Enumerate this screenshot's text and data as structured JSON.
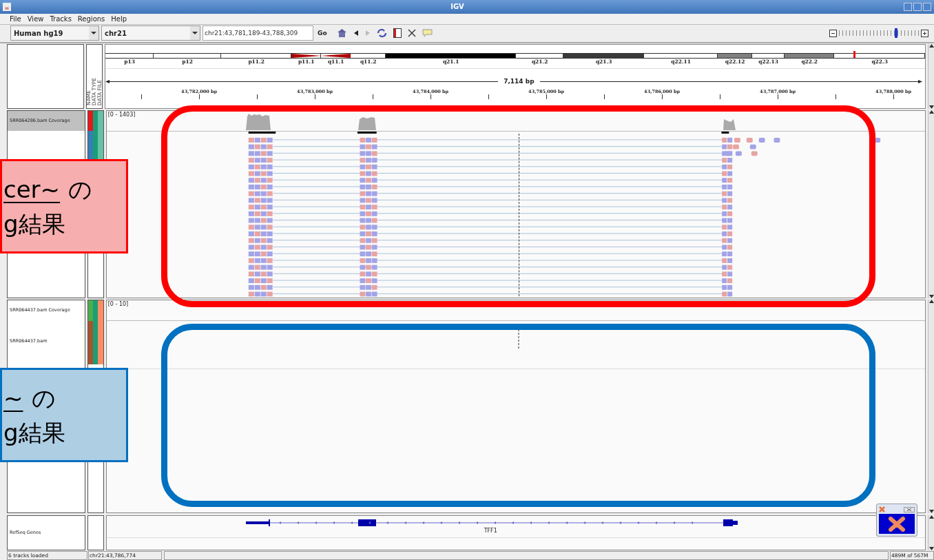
{
  "window": {
    "title": "IGV"
  },
  "menu": [
    "File",
    "View",
    "Tracks",
    "Regions",
    "Help"
  ],
  "toolbar": {
    "genome": "Human hg19",
    "chromosome": "chr21",
    "locus": "chr21:43,781,189-43,788,309",
    "go": "Go",
    "zoom": {
      "level": 0.72
    }
  },
  "ideogram": {
    "bands": [
      {
        "label": "p13",
        "color": "#ffffff"
      },
      {
        "label": "p12",
        "color": "#ffffff"
      },
      {
        "label": "p11.2",
        "color": "#ffffff"
      },
      {
        "label": "p11.1",
        "color": "#b00000",
        "kind": "centromere"
      },
      {
        "label": "q11.1",
        "color": "#b00000",
        "kind": "centromere"
      },
      {
        "label": "q11.2",
        "color": "#ffffff"
      },
      {
        "label": "q21.1",
        "color": "#000000"
      },
      {
        "label": "q21.2",
        "color": "#ffffff"
      },
      {
        "label": "q21.3",
        "color": "#3a3a3a"
      },
      {
        "label": "q22.11",
        "color": "#ffffff"
      },
      {
        "label": "q22.12",
        "color": "#808080"
      },
      {
        "label": "q22.13",
        "color": "#ffffff"
      },
      {
        "label": "q22.2",
        "color": "#808080"
      },
      {
        "label": "q22.3",
        "color": "#ffffff"
      }
    ]
  },
  "ruler": {
    "span": "7,114 bp",
    "ticks": [
      "43,782,000 bp",
      "43,783,000 bp",
      "43,784,000 bp",
      "43,785,000 bp",
      "43,786,000 bp",
      "43,787,000 bp",
      "43,788,000 bp"
    ]
  },
  "attribute_headers": [
    "NAME",
    "DATA TYPE",
    "DATA FILE"
  ],
  "panels": [
    {
      "range": "[0 - 1403]",
      "tracks": [
        {
          "name": "SRR064286.bam Coverage",
          "kind": "coverage",
          "selected": true,
          "attributes": [
            {
              "color": "#e31a1c"
            },
            {
              "color": "#1b9e77"
            },
            {
              "color": "#66c2a5"
            }
          ]
        },
        {
          "kind": "alignments",
          "selected": false,
          "attributes": [
            {
              "color": "#377eb8"
            },
            {
              "color": "#1b9e77"
            },
            {
              "color": "#66c2a5"
            }
          ]
        }
      ]
    },
    {
      "range": "[0 - 10]",
      "tracks": [
        {
          "name": "SRR064437.bam Coverage",
          "kind": "coverage",
          "selected": false,
          "attributes": [
            {
              "color": "#4daf4a"
            },
            {
              "color": "#1b9e77"
            },
            {
              "color": "#fc8d62"
            }
          ]
        },
        {
          "name": "SRR064437.bam",
          "kind": "alignments",
          "selected": false,
          "attributes": [
            {
              "color": "#a6542e"
            },
            {
              "color": "#1b9e77"
            },
            {
              "color": "#fc8d62"
            }
          ]
        }
      ]
    }
  ],
  "genes": {
    "name": "RefSeq Genes",
    "gene": "TFF1"
  },
  "annotations": [
    {
      "underlined": "cer~",
      "after": "の",
      "line_2": "g結果",
      "color": "#ff0000"
    },
    {
      "underlined": "~",
      "after": "の",
      "line_2": "g結果",
      "color": "#0070c0"
    }
  ],
  "status_bar": [
    "6 tracks loaded",
    "chr21:43,786,774",
    "489M of 567M"
  ]
}
